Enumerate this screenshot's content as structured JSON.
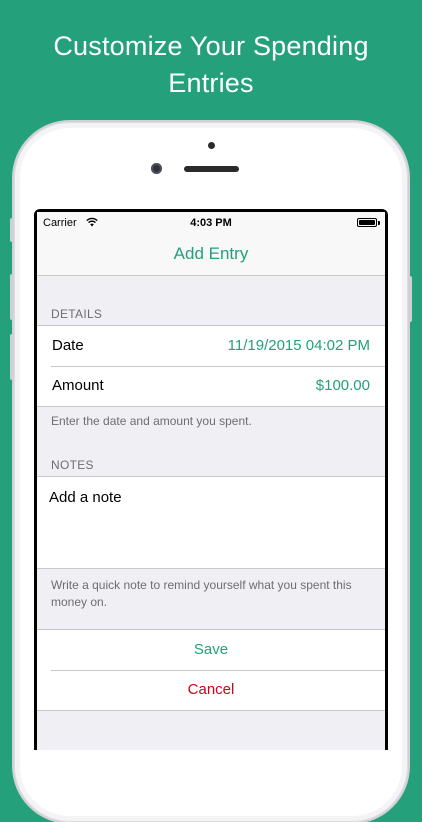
{
  "promo": {
    "headline_line1": "Customize Your Spending",
    "headline_line2": "Entries"
  },
  "statusbar": {
    "carrier": "Carrier",
    "time": "4:03 PM"
  },
  "navbar": {
    "title": "Add Entry"
  },
  "details": {
    "header": "DETAILS",
    "rows": [
      {
        "label": "Date",
        "value": "11/19/2015 04:02 PM"
      },
      {
        "label": "Amount",
        "value": "$100.00"
      }
    ],
    "footer": "Enter the date and amount you spent."
  },
  "notes": {
    "header": "NOTES",
    "placeholder": "Add a note",
    "footer": "Write a quick note to remind yourself what you spent this money on."
  },
  "actions": {
    "save_label": "Save",
    "cancel_label": "Cancel"
  },
  "colors": {
    "background": "#24a07a",
    "accent": "#24a07a",
    "destructive": "#d0021b"
  }
}
